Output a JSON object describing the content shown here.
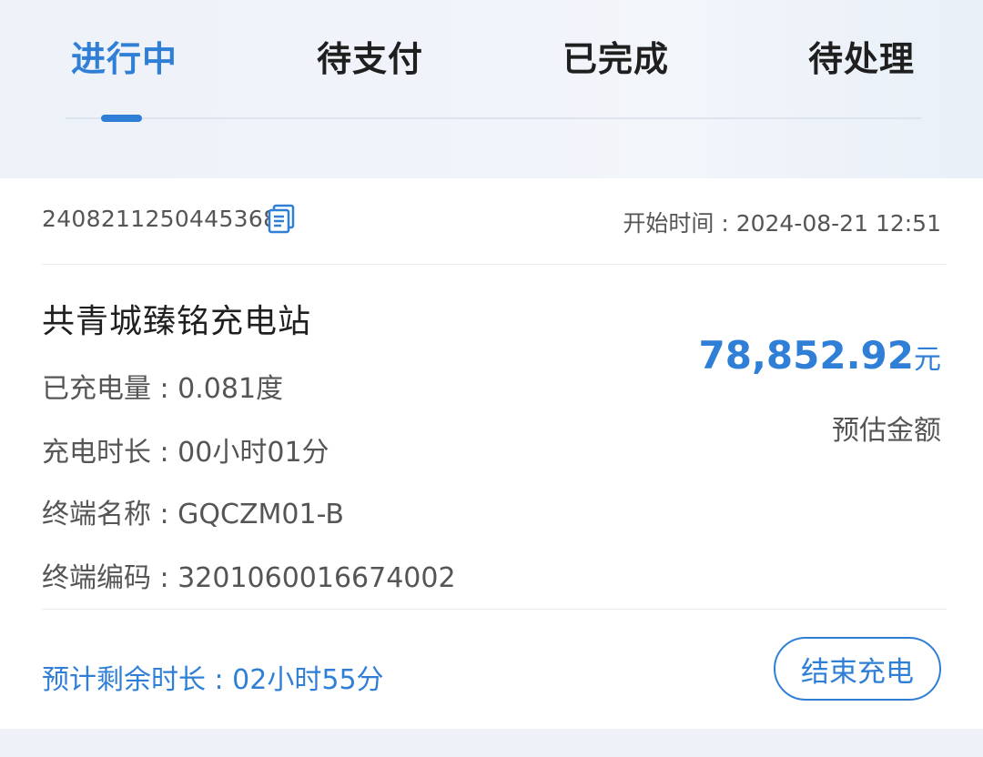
{
  "tabs": [
    {
      "label": "进行中",
      "active": true
    },
    {
      "label": "待支付",
      "active": false
    },
    {
      "label": "已完成",
      "active": false
    },
    {
      "label": "待处理",
      "active": false
    }
  ],
  "order": {
    "number": "2408211250445368",
    "start_time": "开始时间 : 2024-08-21 12:51",
    "station_name": "共青城臻铭充电站",
    "details": [
      "已充电量 : 0.081度",
      "充电时长 : 00小时01分",
      "终端名称 : GQCZM01-B",
      "终端编码 : 3201060016674002"
    ],
    "amount": "78,852.92",
    "amount_unit": "元",
    "amount_label": "预估金额",
    "remaining": "预计剩余时长 : 02小时55分",
    "end_button": "结束充电"
  },
  "icons": {
    "copy": "copy-icon"
  },
  "colors": {
    "accent": "#2f7fd6",
    "text_dark": "#1f1f1f",
    "text_muted": "#555555",
    "page_bg": "#eef2f8"
  }
}
